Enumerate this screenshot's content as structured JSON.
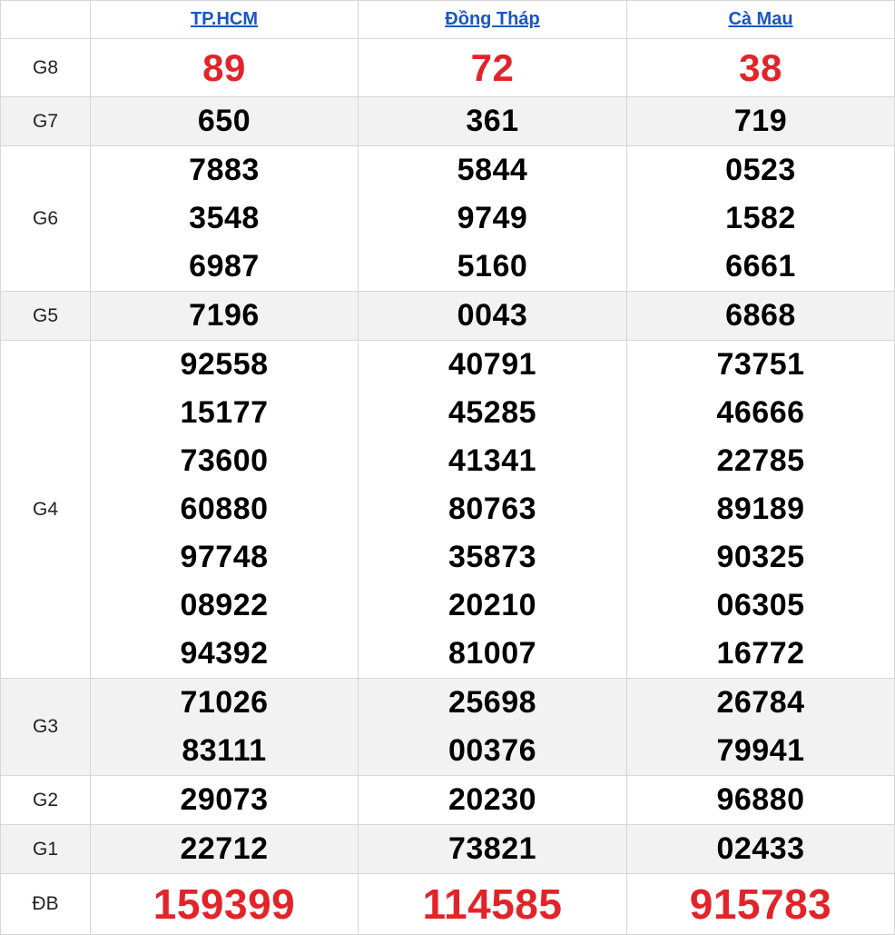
{
  "provinces": [
    "TP.HCM",
    "Đồng Tháp",
    "Cà Mau"
  ],
  "colors": {
    "link": "#1a56c4",
    "highlight": "#e2242a",
    "alt_row": "#f2f2f2"
  },
  "prizes": [
    {
      "label": "G8",
      "style": "g8",
      "alt": false,
      "values": [
        [
          "89"
        ],
        [
          "72"
        ],
        [
          "38"
        ]
      ]
    },
    {
      "label": "G7",
      "style": "normal",
      "alt": true,
      "values": [
        [
          "650"
        ],
        [
          "361"
        ],
        [
          "719"
        ]
      ]
    },
    {
      "label": "G6",
      "style": "normal",
      "alt": false,
      "values": [
        [
          "7883",
          "3548",
          "6987"
        ],
        [
          "5844",
          "9749",
          "5160"
        ],
        [
          "0523",
          "1582",
          "6661"
        ]
      ]
    },
    {
      "label": "G5",
      "style": "normal",
      "alt": true,
      "values": [
        [
          "7196"
        ],
        [
          "0043"
        ],
        [
          "6868"
        ]
      ]
    },
    {
      "label": "G4",
      "style": "normal",
      "alt": false,
      "values": [
        [
          "92558",
          "15177",
          "73600",
          "60880",
          "97748",
          "08922",
          "94392"
        ],
        [
          "40791",
          "45285",
          "41341",
          "80763",
          "35873",
          "20210",
          "81007"
        ],
        [
          "73751",
          "46666",
          "22785",
          "89189",
          "90325",
          "06305",
          "16772"
        ]
      ]
    },
    {
      "label": "G3",
      "style": "normal",
      "alt": true,
      "values": [
        [
          "71026",
          "83111"
        ],
        [
          "25698",
          "00376"
        ],
        [
          "26784",
          "79941"
        ]
      ]
    },
    {
      "label": "G2",
      "style": "normal",
      "alt": false,
      "values": [
        [
          "29073"
        ],
        [
          "20230"
        ],
        [
          "96880"
        ]
      ]
    },
    {
      "label": "G1",
      "style": "normal",
      "alt": true,
      "values": [
        [
          "22712"
        ],
        [
          "73821"
        ],
        [
          "02433"
        ]
      ]
    },
    {
      "label": "ĐB",
      "style": "big",
      "alt": false,
      "values": [
        [
          "159399"
        ],
        [
          "114585"
        ],
        [
          "915783"
        ]
      ]
    }
  ]
}
